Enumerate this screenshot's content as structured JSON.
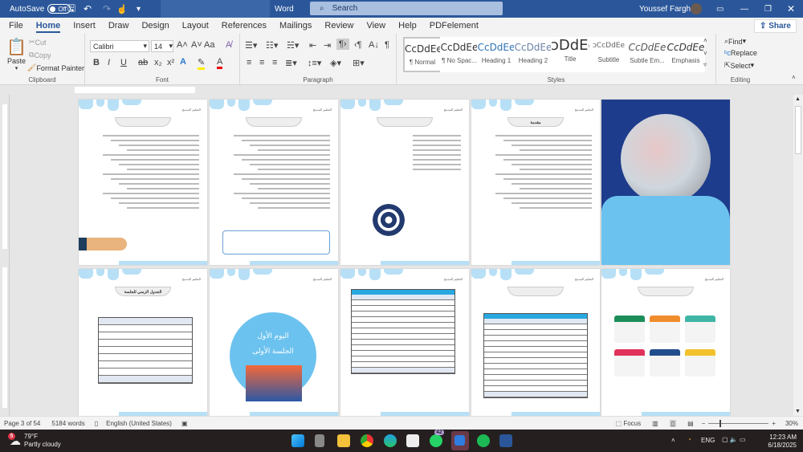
{
  "titlebar": {
    "autosave": "AutoSave",
    "autosave_state": "Off",
    "app": "Word",
    "search": "Search",
    "user": "Youssef Farghaly"
  },
  "tabs": [
    "File",
    "Home",
    "Insert",
    "Draw",
    "Design",
    "Layout",
    "References",
    "Mailings",
    "Review",
    "View",
    "Help",
    "PDFelement"
  ],
  "share": "Share",
  "clipboard": {
    "paste": "Paste",
    "cut": "Cut",
    "copy": "Copy",
    "format_painter": "Format Painter",
    "label": "Clipboard"
  },
  "font": {
    "name": "Calibri",
    "size": "14",
    "label": "Font",
    "bold": "B",
    "italic": "I",
    "underline": "U",
    "case": "Aa"
  },
  "paragraph": {
    "label": "Paragraph"
  },
  "styles": {
    "label": "Styles",
    "items": [
      {
        "sample": "CcDdEe",
        "name": "¶ Normal"
      },
      {
        "sample": "CcDdEe",
        "name": "¶ No Spac..."
      },
      {
        "sample": "CcDdEe",
        "name": "Heading 1"
      },
      {
        "sample": "CcDdEe",
        "name": "Heading 2"
      },
      {
        "sample": "ↄDdEe",
        "name": "Title"
      },
      {
        "sample": "ↄCcDdEe",
        "name": "Subtitle"
      },
      {
        "sample": "CcDdEe",
        "name": "Subtle Em..."
      },
      {
        "sample": "CcDdEe",
        "name": "Emphasis"
      }
    ]
  },
  "editing": {
    "find": "Find",
    "replace": "Replace",
    "select": "Select",
    "label": "Editing"
  },
  "pages": {
    "header": "التعليم المدمج",
    "intro_title": "مقدمة",
    "day_one": "اليوم الأول",
    "session_one": "الجلسة الأولى",
    "schedule_title": "الجدول الزمني للجلسة"
  },
  "status": {
    "page": "Page 3 of 54",
    "words": "5184 words",
    "language": "English (United States)",
    "focus": "Focus",
    "zoom": "30%"
  },
  "taskbar": {
    "temp": "79°F",
    "weather": "Partly cloudy",
    "weather_badge": "5",
    "whatsapp_badge": "42",
    "lang": "ENG",
    "time": "12:23 AM",
    "date": "6/18/2025"
  },
  "colors": {
    "word_blue": "#2b579a",
    "page_accent": "#b7e0f6",
    "cover_blue": "#1e3c8c"
  }
}
